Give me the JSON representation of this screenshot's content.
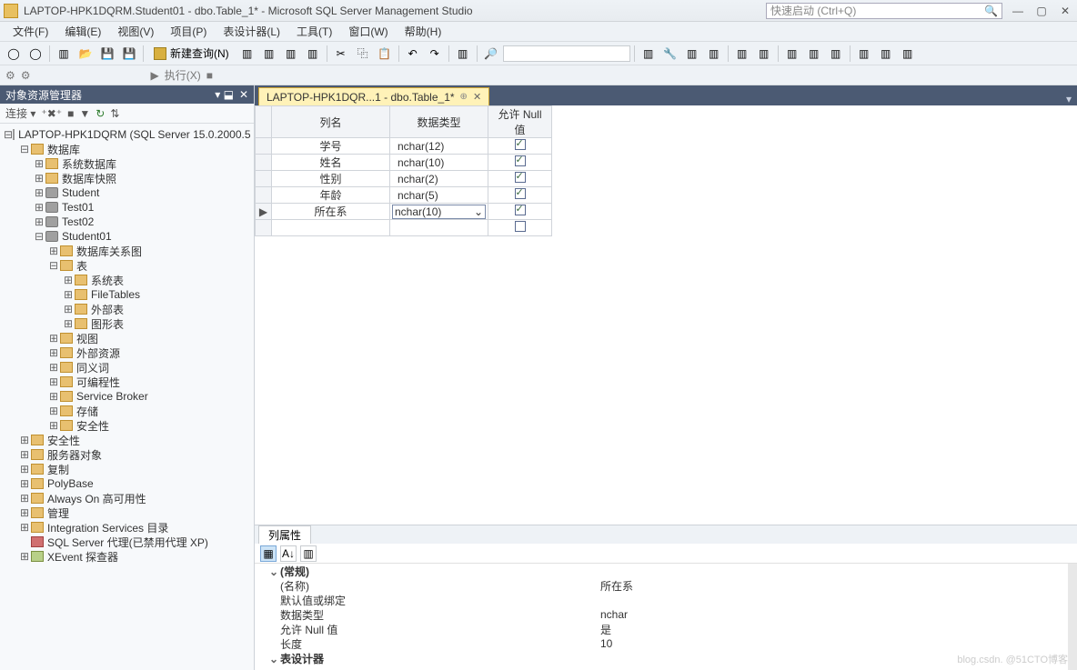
{
  "title": "LAPTOP-HPK1DQRM.Student01 - dbo.Table_1* - Microsoft SQL Server Management Studio",
  "quick_launch_placeholder": "快速启动 (Ctrl+Q)",
  "menu": [
    "文件(F)",
    "编辑(E)",
    "视图(V)",
    "项目(P)",
    "表设计器(L)",
    "工具(T)",
    "窗口(W)",
    "帮助(H)"
  ],
  "toolbar": {
    "new_query": "新建查询(N)",
    "execute": "执行(X)"
  },
  "sidebar": {
    "title": "对象资源管理器",
    "connect": "连接",
    "server": "LAPTOP-HPK1DQRM (SQL Server 15.0.2000.5 -",
    "n_databases": "数据库",
    "n_sysdb": "系统数据库",
    "n_snapshot": "数据库快照",
    "n_student": "Student",
    "n_test01": "Test01",
    "n_test02": "Test02",
    "n_student01": "Student01",
    "n_diagram": "数据库关系图",
    "n_tables": "表",
    "n_systables": "系统表",
    "n_filetables": "FileTables",
    "n_exttables": "外部表",
    "n_graphtables": "图形表",
    "n_views": "视图",
    "n_extres": "外部资源",
    "n_synonyms": "同义词",
    "n_programmability": "可编程性",
    "n_servicebroker": "Service Broker",
    "n_storage": "存储",
    "n_security": "安全性",
    "n_rootsec": "安全性",
    "n_serverobj": "服务器对象",
    "n_replication": "复制",
    "n_polybase": "PolyBase",
    "n_alwayson": "Always On 高可用性",
    "n_management": "管理",
    "n_integration": "Integration Services 目录",
    "n_agent": "SQL Server 代理(已禁用代理 XP)",
    "n_xevent": "XEvent 探查器"
  },
  "doc_tab": "LAPTOP-HPK1DQR...1 - dbo.Table_1*",
  "grid": {
    "h_name": "列名",
    "h_type": "数据类型",
    "h_null": "允许 Null 值",
    "rows": [
      {
        "name": "学号",
        "type": "nchar(12)",
        "null": true,
        "sel": false
      },
      {
        "name": "姓名",
        "type": "nchar(10)",
        "null": true,
        "sel": false
      },
      {
        "name": "性别",
        "type": "nchar(2)",
        "null": true,
        "sel": false
      },
      {
        "name": "年龄",
        "type": "nchar(5)",
        "null": true,
        "sel": false
      },
      {
        "name": "所在系",
        "type": "nchar(10)",
        "null": true,
        "sel": true,
        "editing": true
      }
    ]
  },
  "props": {
    "tab": "列属性",
    "group": "(常规)",
    "p_name_l": "(名称)",
    "p_name_v": "所在系",
    "p_default_l": "默认值或绑定",
    "p_default_v": "",
    "p_type_l": "数据类型",
    "p_type_v": "nchar",
    "p_null_l": "允许 Null 值",
    "p_null_v": "是",
    "p_len_l": "长度",
    "p_len_v": "10",
    "g_designer": "表设计器"
  },
  "watermark": "blog.csdn. @51CTO博客"
}
